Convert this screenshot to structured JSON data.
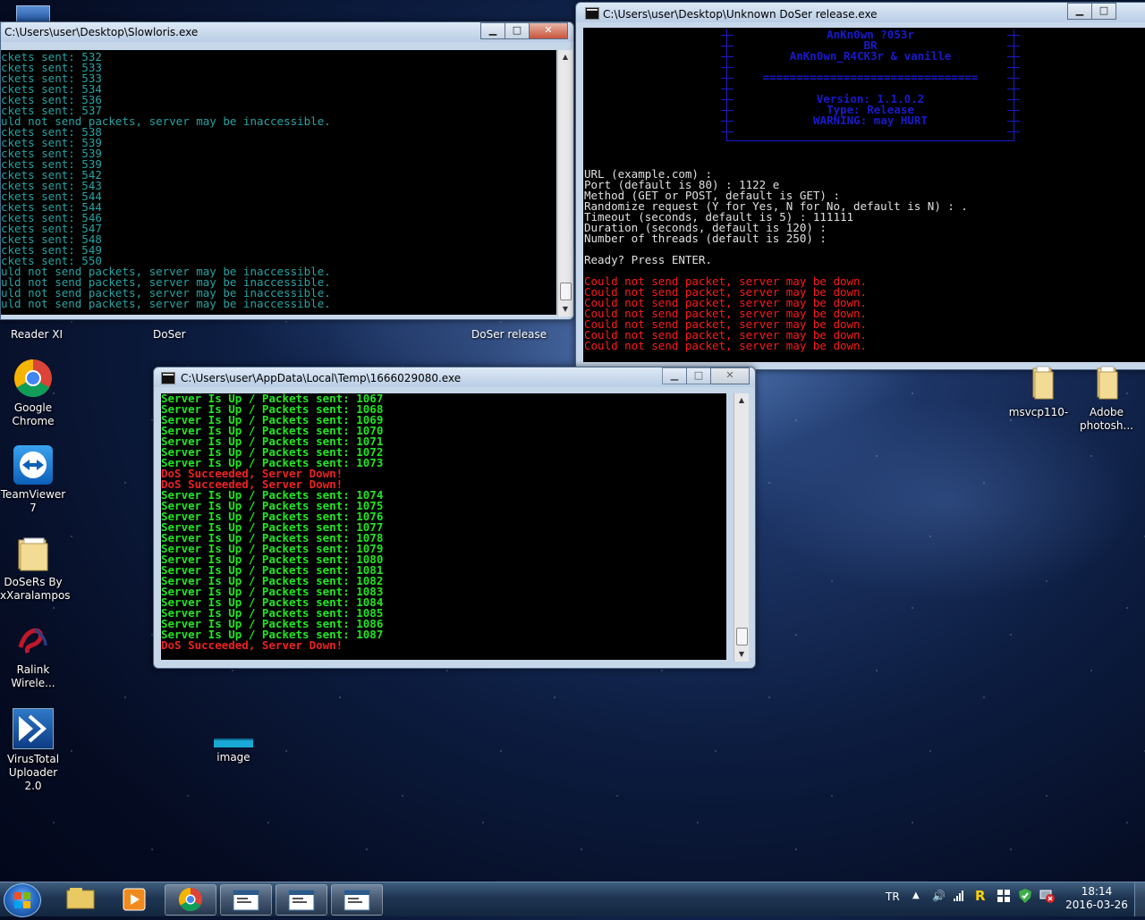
{
  "desktop": {
    "top_labels": [
      "Reader XI",
      "DoSer",
      "DoSer release"
    ],
    "left_icons": [
      {
        "label": "Google\nChrome",
        "icon": "chrome-icon"
      },
      {
        "label": "TeamViewer\n7",
        "icon": "teamviewer-icon"
      },
      {
        "label": "DoSeRs By\nxXaralampos",
        "icon": "folder-icon"
      },
      {
        "label": "Ralink\nWirele...",
        "icon": "ralink-icon"
      },
      {
        "label": "VirusTotal\nUploader 2.0",
        "icon": "virustotal-icon"
      }
    ],
    "right_icons": [
      {
        "label": "msvcp110-",
        "icon": "folder-icon"
      },
      {
        "label": "Adobe\nphotosh...",
        "icon": "folder-icon"
      }
    ],
    "middle_icon": {
      "label": "image",
      "icon": "image-file-icon"
    }
  },
  "slowloris": {
    "title": "C:\\Users\\user\\Desktop\\Slowloris.exe",
    "lines": [
      "ckets sent: 532",
      "ckets sent: 533",
      "ckets sent: 533",
      "ckets sent: 534",
      "ckets sent: 536",
      "ckets sent: 537",
      "uld not send packets, server may be inaccessible.",
      "ckets sent: 538",
      "ckets sent: 539",
      "ckets sent: 539",
      "ckets sent: 539",
      "ckets sent: 542",
      "ckets sent: 543",
      "ckets sent: 544",
      "ckets sent: 544",
      "ckets sent: 546",
      "ckets sent: 547",
      "ckets sent: 548",
      "ckets sent: 549",
      "ckets sent: 550",
      "uld not send packets, server may be inaccessible.",
      "uld not send packets, server may be inaccessible.",
      "uld not send packets, server may be inaccessible.",
      "uld not send packets, server may be inaccessible."
    ]
  },
  "doser_release": {
    "title": "C:\\Users\\user\\Desktop\\Unknown DoSer release.exe",
    "banner": [
      "AnKn0wn ?053r",
      "BR",
      "AnKn0wn_R4CK3r & vanille",
      "",
      "================================",
      "",
      "Version: 1.1.0.2",
      "Type: Release",
      "WARNING: may HURT"
    ],
    "prompts": [
      "URL (example.com) :",
      "Port (default is 80) : 1122 e",
      "Method (GET or POST, default is GET) :",
      "Randomize request (Y for Yes, N for No, default is N) : .",
      "Timeout (seconds, default is 5) : 111111",
      "Duration (seconds, default is 120) :",
      "Number of threads (default is 250) :",
      "",
      "Ready? Press ENTER.",
      ""
    ],
    "errors": [
      "Could not send packet, server may be down.",
      "Could not send packet, server may be down.",
      "Could not send packet, server may be down.",
      "Could not send packet, server may be down.",
      "Could not send packet, server may be down.",
      "Could not send packet, server may be down.",
      "Could not send packet, server may be down."
    ]
  },
  "temp_exe": {
    "title": "C:\\Users\\user\\AppData\\Local\\Temp\\1666029080.exe",
    "lines": [
      {
        "text": "Server Is Up / Packets sent: 1067",
        "status": "up"
      },
      {
        "text": "Server Is Up / Packets sent: 1068",
        "status": "up"
      },
      {
        "text": "Server Is Up / Packets sent: 1069",
        "status": "up"
      },
      {
        "text": "Server Is Up / Packets sent: 1070",
        "status": "up"
      },
      {
        "text": "Server Is Up / Packets sent: 1071",
        "status": "up"
      },
      {
        "text": "Server Is Up / Packets sent: 1072",
        "status": "up"
      },
      {
        "text": "Server Is Up / Packets sent: 1073",
        "status": "up"
      },
      {
        "text": "DoS Succeeded, Server Down!",
        "status": "down"
      },
      {
        "text": "DoS Succeeded, Server Down!",
        "status": "down"
      },
      {
        "text": "Server Is Up / Packets sent: 1074",
        "status": "up"
      },
      {
        "text": "Server Is Up / Packets sent: 1075",
        "status": "up"
      },
      {
        "text": "Server Is Up / Packets sent: 1076",
        "status": "up"
      },
      {
        "text": "Server Is Up / Packets sent: 1077",
        "status": "up"
      },
      {
        "text": "Server Is Up / Packets sent: 1078",
        "status": "up"
      },
      {
        "text": "Server Is Up / Packets sent: 1079",
        "status": "up"
      },
      {
        "text": "Server Is Up / Packets sent: 1080",
        "status": "up"
      },
      {
        "text": "Server Is Up / Packets sent: 1081",
        "status": "up"
      },
      {
        "text": "Server Is Up / Packets sent: 1082",
        "status": "up"
      },
      {
        "text": "Server Is Up / Packets sent: 1083",
        "status": "up"
      },
      {
        "text": "Server Is Up / Packets sent: 1084",
        "status": "up"
      },
      {
        "text": "Server Is Up / Packets sent: 1085",
        "status": "up"
      },
      {
        "text": "Server Is Up / Packets sent: 1086",
        "status": "up"
      },
      {
        "text": "Server Is Up / Packets sent: 1087",
        "status": "up"
      },
      {
        "text": "DoS Succeeded, Server Down!",
        "status": "down"
      }
    ]
  },
  "taskbar": {
    "buttons": [
      "start-orb",
      "explorer-icon",
      "media-player-icon",
      "chrome-icon",
      "console-icon",
      "console-icon",
      "console-icon"
    ],
    "tray": {
      "lang": "TR",
      "time": "18:14",
      "date": "2016-03-26"
    }
  }
}
